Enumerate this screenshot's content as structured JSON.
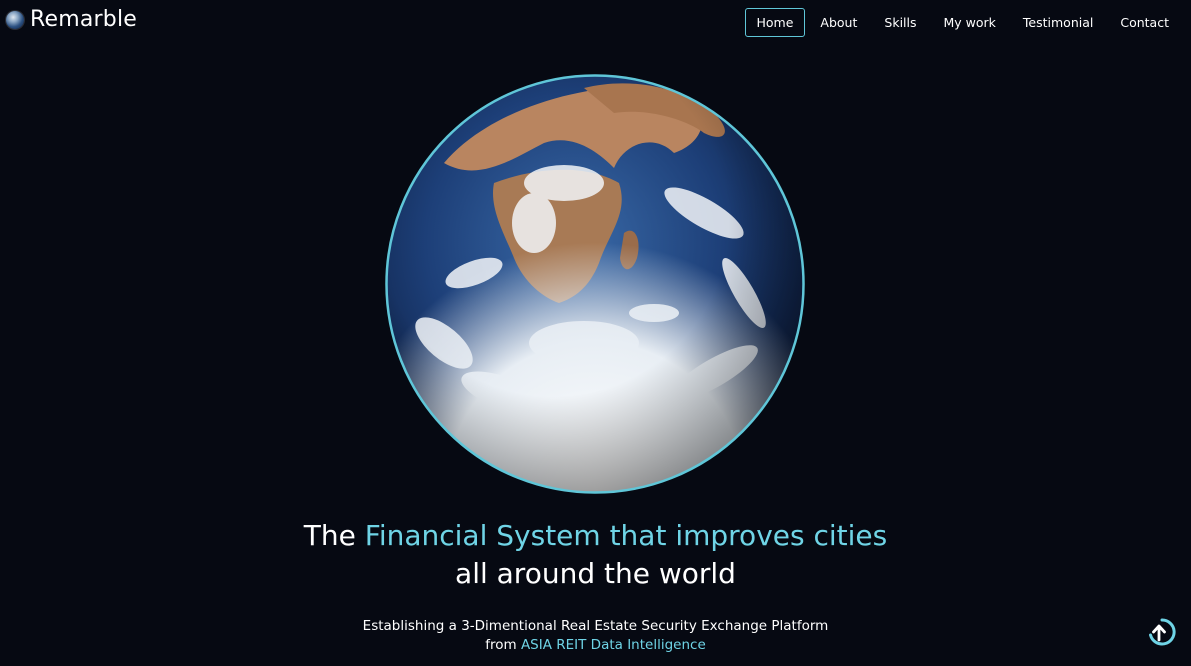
{
  "brand": {
    "name": "Remarble",
    "logo_icon": "globe-icon"
  },
  "nav": {
    "items": [
      {
        "label": "Home",
        "active": true
      },
      {
        "label": "About",
        "active": false
      },
      {
        "label": "Skills",
        "active": false
      },
      {
        "label": "My work",
        "active": false
      },
      {
        "label": "Testimonial",
        "active": false
      },
      {
        "label": "Contact",
        "active": false
      }
    ]
  },
  "hero": {
    "headline_prefix": "The ",
    "headline_accent": "Financial System that improves cities",
    "headline_line2": "all around the world",
    "subline_line1": "Establishing a 3-Dimentional Real Estate Security Exchange Platform",
    "subline_prefix": "from ",
    "subline_accent": "ASIA REIT Data Intelligence"
  },
  "scroll_button": {
    "icon": "arrow-up-icon"
  },
  "colors": {
    "background": "#060912",
    "accent": "#6fd4e6",
    "text": "#ffffff",
    "globe_ring": "#5fc6d8"
  }
}
